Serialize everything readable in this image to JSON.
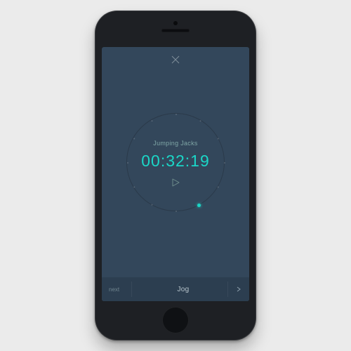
{
  "colors": {
    "screen_bg": "#33475b",
    "accent": "#1bd6c7",
    "bar_bg": "#2c3e50"
  },
  "close_icon": "close",
  "timer": {
    "exercise_label": "Jumping Jacks",
    "time_display": "00:32:19",
    "play_icon": "play",
    "progress_fraction": 0.42
  },
  "next_bar": {
    "prefix": "next",
    "activity": "Jog",
    "chevron": "chevron-right"
  }
}
